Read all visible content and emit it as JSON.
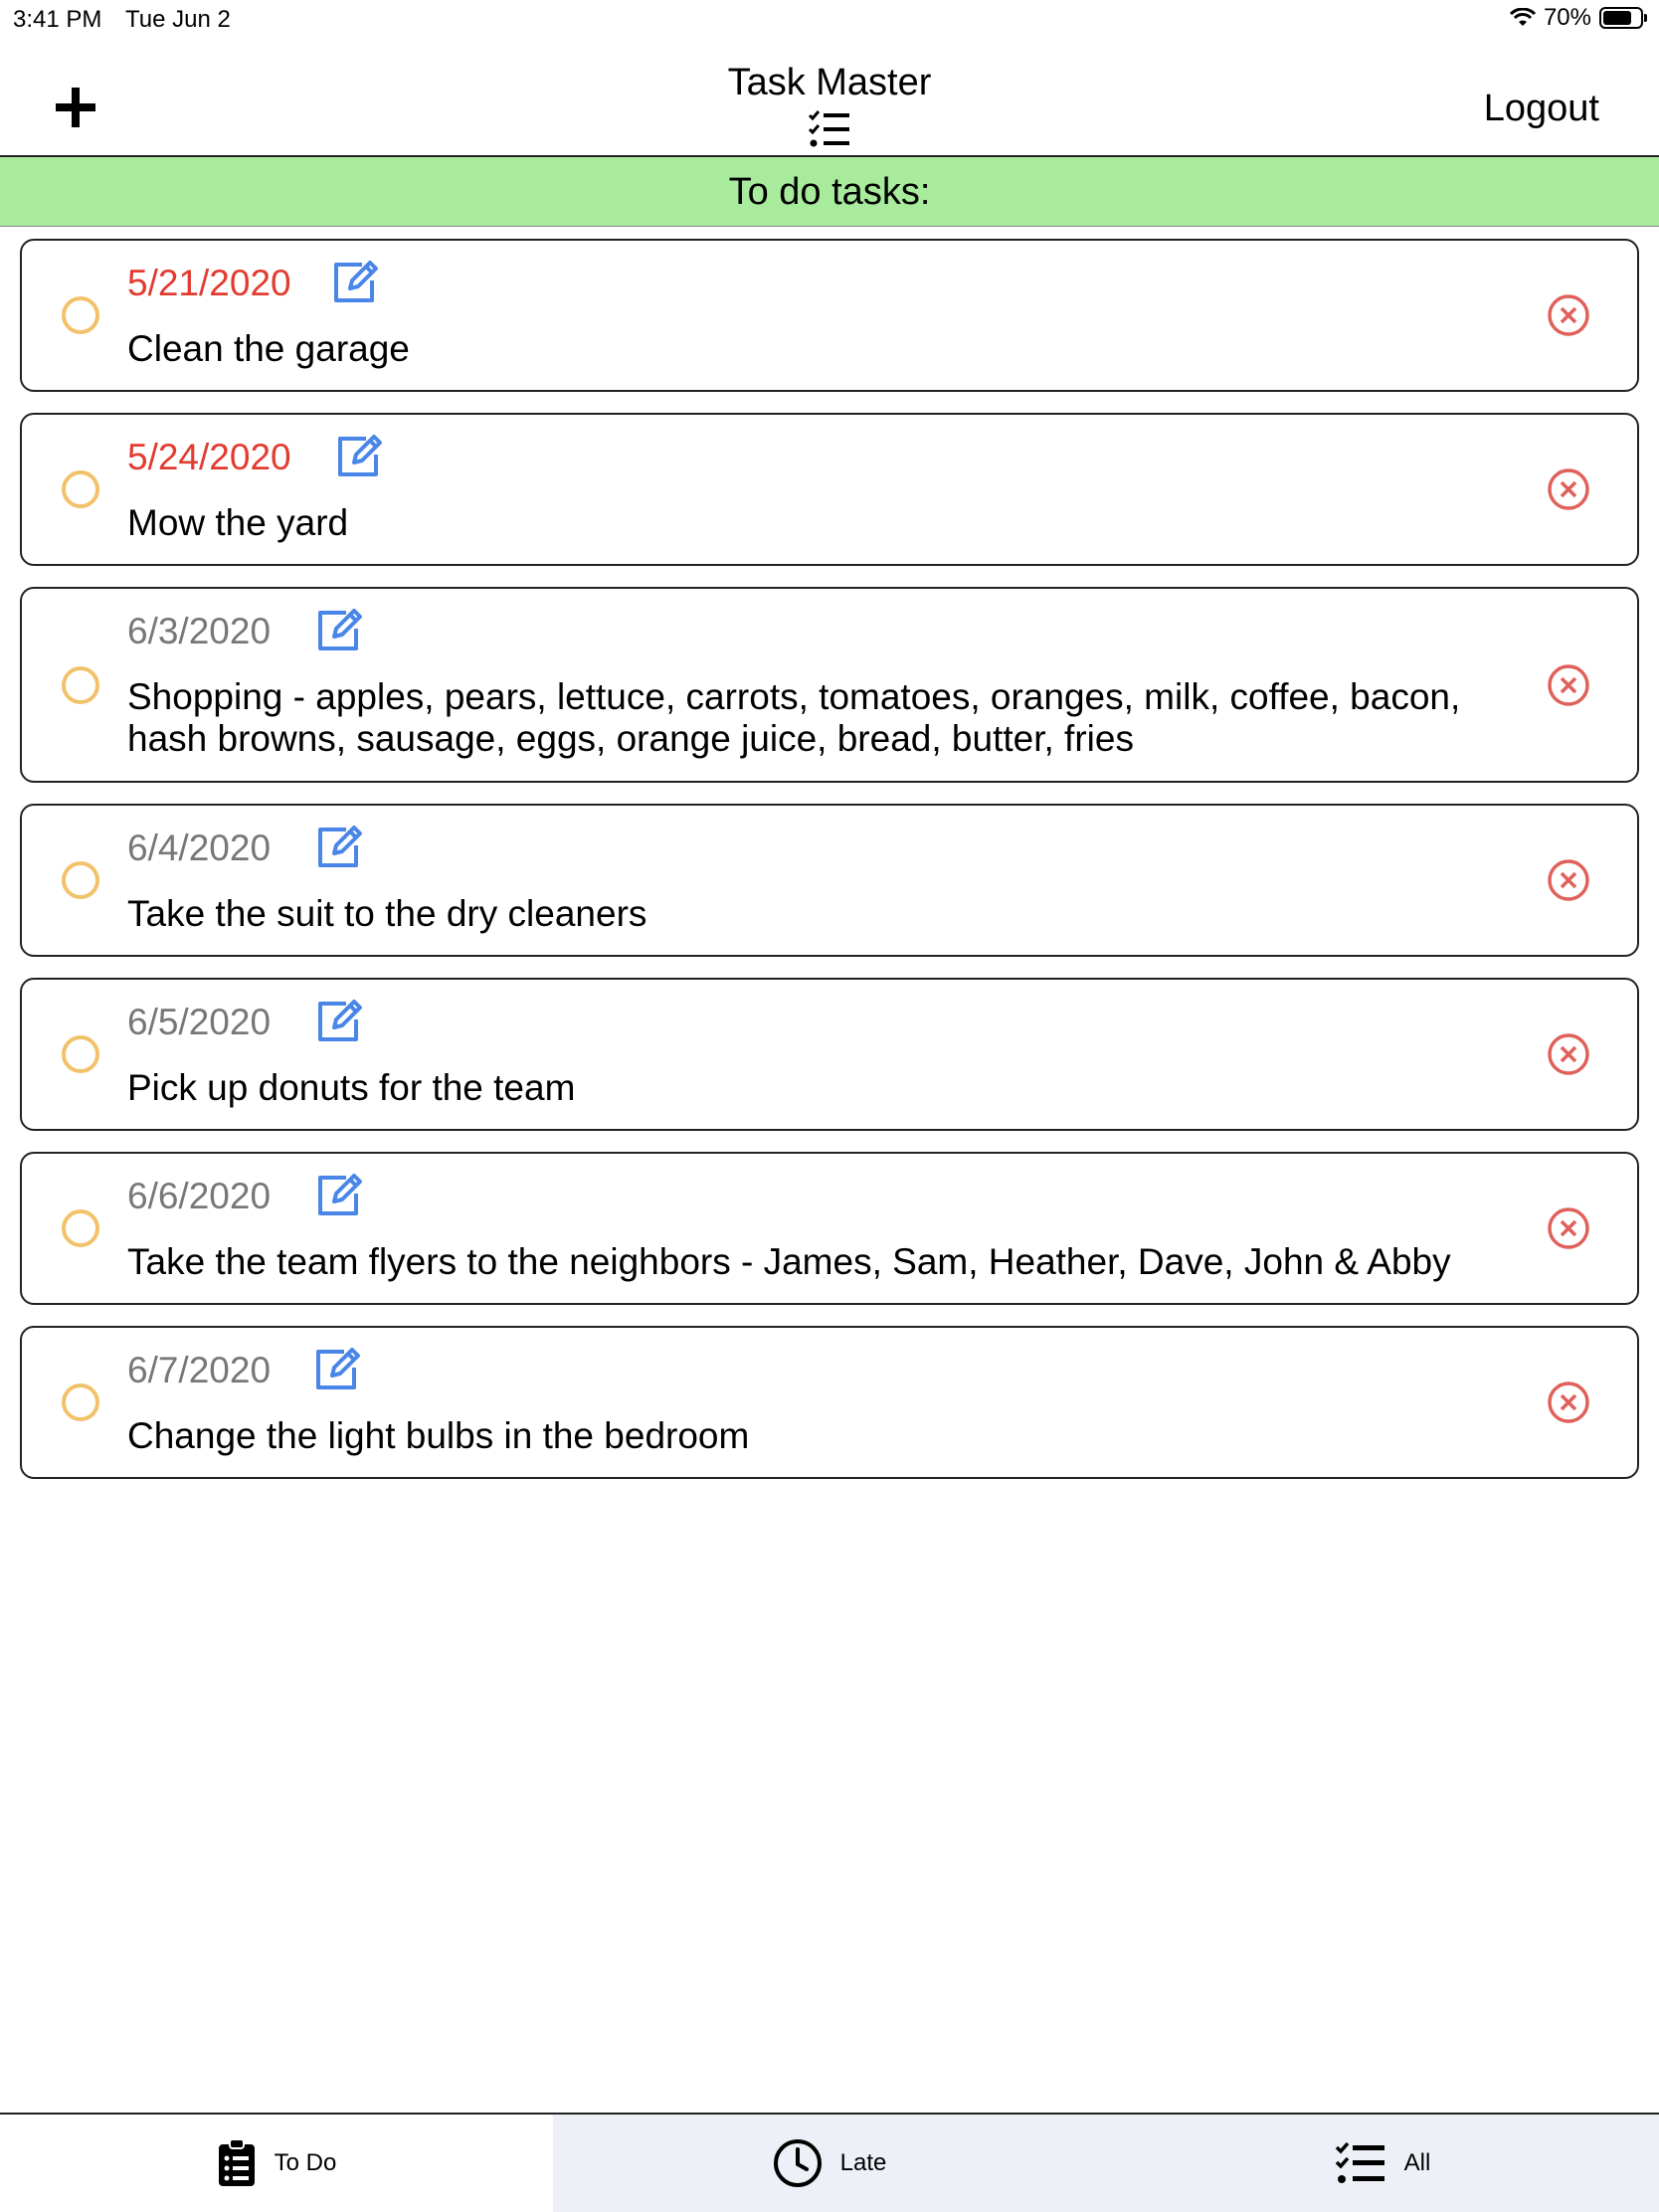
{
  "status_bar": {
    "time": "3:41 PM",
    "date": "Tue Jun 2",
    "battery": "70%",
    "wifi_icon": "wifi-icon",
    "battery_icon": "battery-icon"
  },
  "nav": {
    "title": "Task Master",
    "add_icon": "plus-icon",
    "title_icon": "checklist-icon",
    "logout_label": "Logout"
  },
  "section": {
    "title": "To do tasks:"
  },
  "tasks": [
    {
      "date": "5/21/2020",
      "text": "Clean the garage",
      "overdue": true
    },
    {
      "date": "5/24/2020",
      "text": "Mow the yard",
      "overdue": true
    },
    {
      "date": "6/3/2020",
      "text": "Shopping - apples, pears, lettuce, carrots, tomatoes, oranges, milk, coffee, bacon, hash browns, sausage, eggs, orange juice, bread, butter, fries",
      "overdue": false
    },
    {
      "date": "6/4/2020",
      "text": "Take the suit to the dry cleaners",
      "overdue": false
    },
    {
      "date": "6/5/2020",
      "text": "Pick up donuts for the team",
      "overdue": false
    },
    {
      "date": "6/6/2020",
      "text": "Take the team flyers to the neighbors - James, Sam, Heather, Dave, John & Abby",
      "overdue": false
    },
    {
      "date": "6/7/2020",
      "text": "Change the light bulbs in the bedroom",
      "overdue": false
    }
  ],
  "tabs": [
    {
      "label": "To Do",
      "icon": "clipboard-list-icon",
      "active": true
    },
    {
      "label": "Late",
      "icon": "clock-icon",
      "active": false
    },
    {
      "label": "All",
      "icon": "checklist-icon",
      "active": false
    }
  ],
  "colors": {
    "header_bg": "#a8eb9c",
    "overdue": "#e23b30",
    "upcoming": "#777777",
    "edit": "#4a86e8",
    "delete": "#e0605a",
    "checkbox": "#f2c26a"
  }
}
